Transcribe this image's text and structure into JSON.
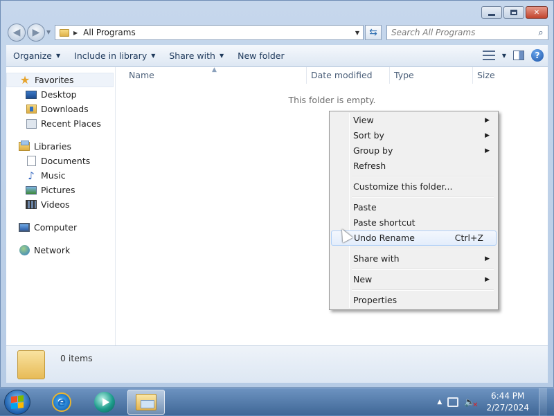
{
  "address": {
    "breadcrumb": "All Programs"
  },
  "search": {
    "placeholder": "Search All Programs"
  },
  "toolbar": {
    "organize": "Organize",
    "include_in_library": "Include in library",
    "share_with": "Share with",
    "new_folder": "New folder"
  },
  "sidebar": {
    "favorites": {
      "label": "Favorites",
      "items": [
        "Desktop",
        "Downloads",
        "Recent Places"
      ]
    },
    "libraries": {
      "label": "Libraries",
      "items": [
        "Documents",
        "Music",
        "Pictures",
        "Videos"
      ]
    },
    "computer": "Computer",
    "network": "Network"
  },
  "columns": [
    "Name",
    "Date modified",
    "Type",
    "Size"
  ],
  "empty_message": "This folder is empty.",
  "context_menu": {
    "view": "View",
    "sort_by": "Sort by",
    "group_by": "Group by",
    "refresh": "Refresh",
    "customize": "Customize this folder...",
    "paste": "Paste",
    "paste_shortcut": "Paste shortcut",
    "undo_rename": "Undo Rename",
    "undo_shortcut": "Ctrl+Z",
    "share_with": "Share with",
    "new": "New",
    "properties": "Properties"
  },
  "details": {
    "item_count": "0 items"
  },
  "taskbar": {
    "time": "6:44 PM",
    "date": "2/27/2024"
  },
  "icons": {
    "favorites": "star-icon",
    "desktop": "desktop-icon",
    "downloads": "downloads-folder-icon",
    "recent": "recent-places-icon",
    "libraries": "libraries-icon",
    "documents": "documents-icon",
    "music": "music-note-icon",
    "pictures": "pictures-icon",
    "videos": "film-icon",
    "computer": "computer-icon",
    "network": "network-globe-icon"
  }
}
